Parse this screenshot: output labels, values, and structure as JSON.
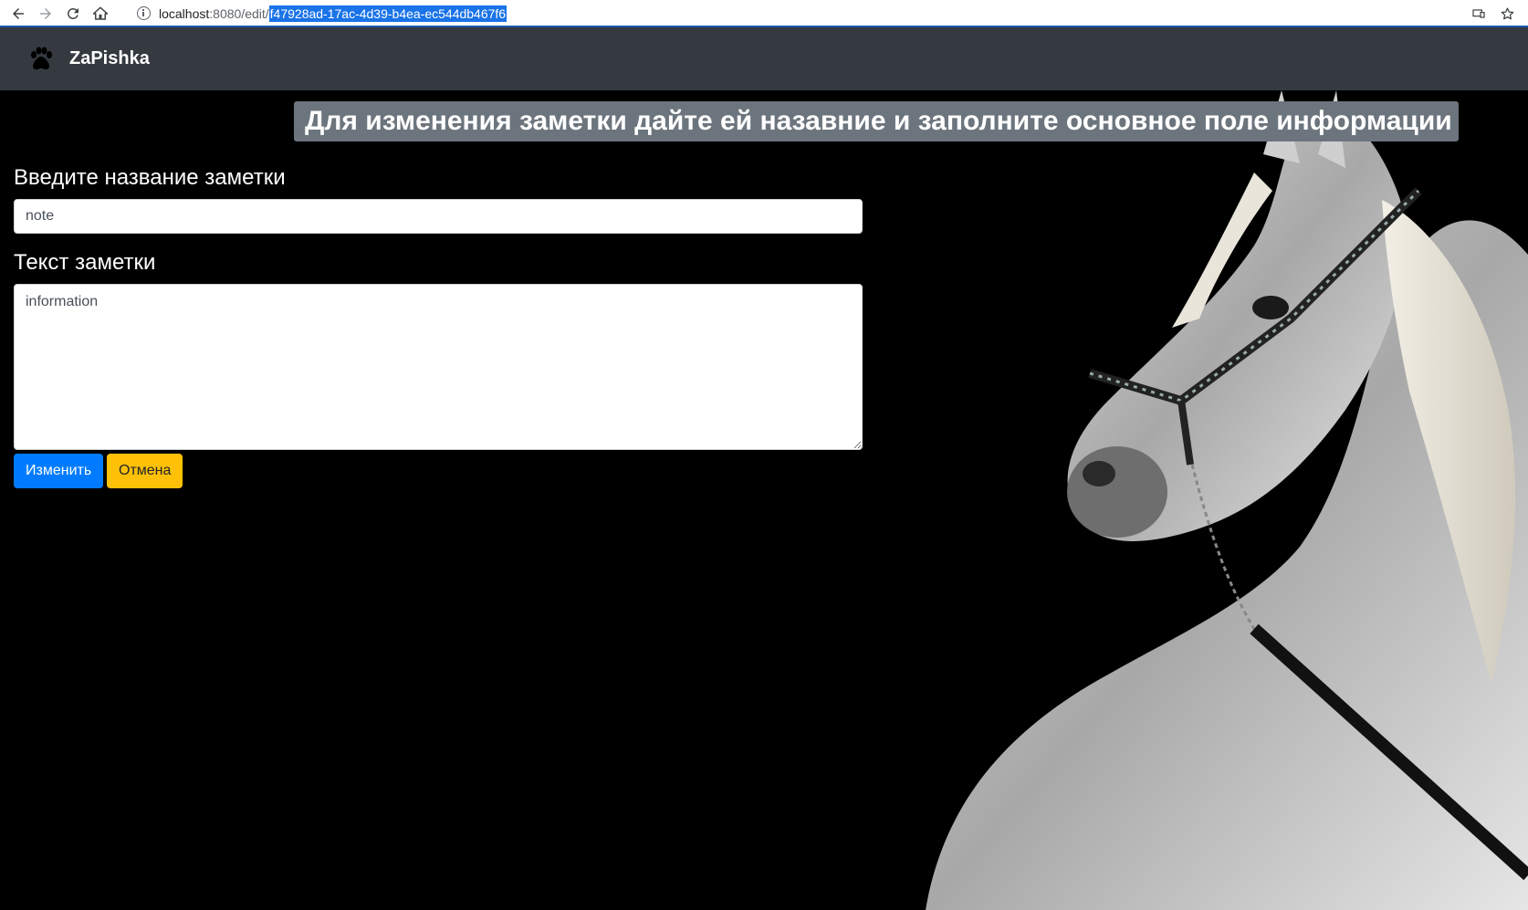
{
  "browser": {
    "url_host": "localhost",
    "url_port_path": ":8080/edit/",
    "url_selected": "f47928ad-17ac-4d39-b4ea-ec544db467f6",
    "icons": [
      "back-icon",
      "forward-icon",
      "reload-icon",
      "home-icon",
      "info-icon",
      "cast-icon",
      "bookmark-star-icon"
    ]
  },
  "navbar": {
    "brand_icon": "paw-icon",
    "brand_name": "ZaPishka",
    "background": "#343a40"
  },
  "page": {
    "heading": "Для изменения заметки дайте ей назавние и заполните основное поле информации",
    "heading_bg": "#6c757d"
  },
  "form": {
    "title_label": "Введите название заметки",
    "title_value": "note",
    "body_label": "Текст заметки",
    "body_value": "information",
    "submit_label": "Изменить",
    "cancel_label": "Отмена",
    "submit_color": "#007bff",
    "cancel_color": "#ffc107"
  },
  "background_image": "white-horse-photo"
}
